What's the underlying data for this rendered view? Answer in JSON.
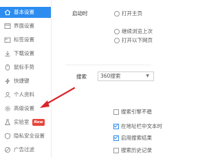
{
  "sidebar": {
    "items": [
      {
        "label": "基本设置",
        "icon": "home-icon"
      },
      {
        "label": "界面设置",
        "icon": "layout-icon"
      },
      {
        "label": "标签设置",
        "icon": "tab-icon"
      },
      {
        "label": "下载设置",
        "icon": "download-icon"
      },
      {
        "label": "鼠标手势",
        "icon": "mouse-gesture-icon"
      },
      {
        "label": "快捷键",
        "icon": "keyboard-icon"
      },
      {
        "label": "个人资料",
        "icon": "user-icon"
      },
      {
        "label": "高级设置",
        "icon": "gear-icon"
      },
      {
        "label": "实验室",
        "icon": "flask-icon",
        "badge": "New"
      },
      {
        "label": "隐私安全设置",
        "icon": "shield-icon"
      },
      {
        "label": "广告过滤",
        "icon": "ad-block-icon"
      }
    ]
  },
  "main": {
    "startup": {
      "label": "启动时",
      "option_open_home": "打开主页",
      "option_continue": "继续浏览上次",
      "option_open_pages": "打开以下网页"
    },
    "search": {
      "label": "搜索",
      "engine": "360搜索",
      "option_1": "搜索引擎不稳",
      "option_2": "在地址栏中文本时",
      "option_3": "启用搜索结果",
      "option_4": "搜索历史记录"
    }
  },
  "colors": {
    "accent": "#2d8cf0",
    "annotation_arrow": "#d9252b",
    "badge": "#e8453c"
  }
}
